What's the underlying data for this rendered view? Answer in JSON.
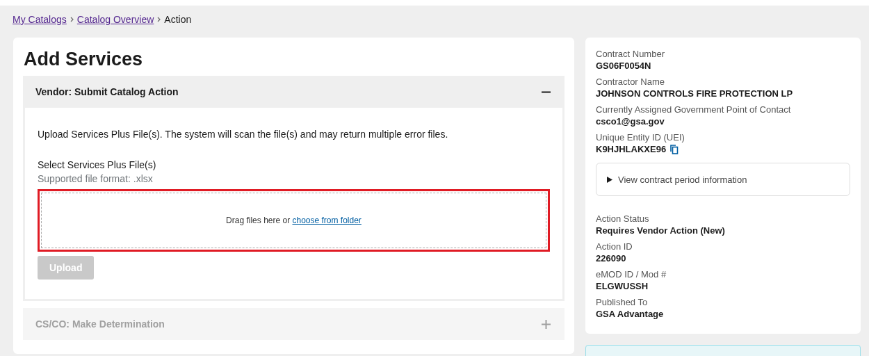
{
  "breadcrumb": [
    {
      "label": "My Catalogs",
      "link": true
    },
    {
      "label": "Catalog Overview",
      "link": true
    },
    {
      "label": "Action",
      "link": false
    }
  ],
  "main": {
    "title": "Add Services",
    "accordions": [
      {
        "title": "Vendor: Submit Catalog Action",
        "expanded": true,
        "disabled": false,
        "intro": "Upload Services Plus File(s). The system will scan the file(s) and may return multiple error files.",
        "field_label": "Select Services Plus File(s)",
        "hint": "Supported file format: .xlsx",
        "drop_text": "Drag files here or ",
        "drop_link": "choose from folder",
        "highlighted": true,
        "button": {
          "label": "Upload",
          "disabled": true
        }
      },
      {
        "title": "CS/CO: Make Determination",
        "expanded": false,
        "disabled": true
      }
    ]
  },
  "summary": {
    "fields": [
      {
        "label": "Contract Number",
        "value": "GS06F0054N",
        "kind": "plain"
      },
      {
        "label": "Contractor Name",
        "value": "JOHNSON CONTROLS FIRE PROTECTION LP",
        "kind": "plain"
      },
      {
        "label": "Currently Assigned Government Point of Contact",
        "value": "csco1@gsa.gov",
        "kind": "plain"
      },
      {
        "label": "Unique Entity ID (UEI)",
        "value": "K9HJHLAKXE96",
        "kind": "copyable"
      }
    ],
    "details": {
      "label": "View contract period information",
      "expanded": false
    },
    "status_fields": [
      {
        "label": "Action Status",
        "value": "Requires Vendor Action (New)"
      },
      {
        "label": "Action ID",
        "value": "226090"
      },
      {
        "label": "eMOD ID / Mod #",
        "value": "ELGWUSSH"
      },
      {
        "label": "Published To",
        "value": "GSA Advantage"
      }
    ]
  }
}
